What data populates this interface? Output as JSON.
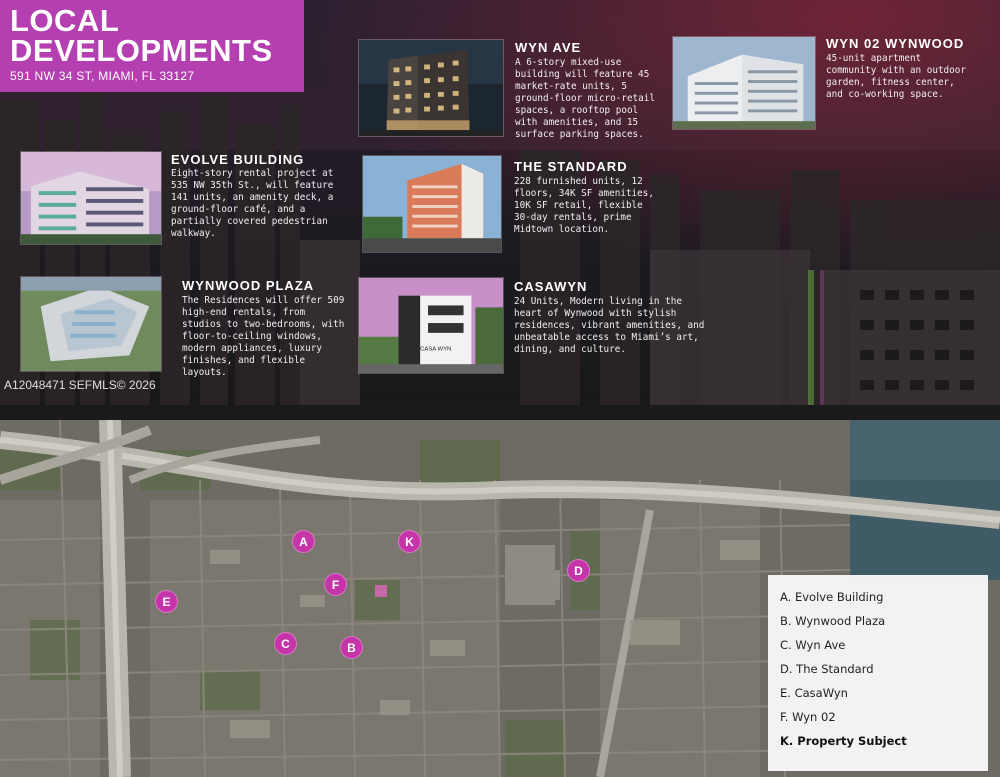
{
  "header": {
    "title": "LOCAL DEVELOPMENTS",
    "address": "591 NW 34 ST, MIAMI, FL 33127"
  },
  "developments": [
    {
      "id": "wyn-ave",
      "title": "WYN AVE",
      "text": "A 6-story mixed-use building will feature 45 market-rate units, 5 ground-floor micro-retail spaces, a rooftop pool with amenities, and 15 surface parking spaces."
    },
    {
      "id": "wyn-02",
      "title": "WYN 02 WYNWOOD",
      "text": "45-unit apartment community with an outdoor garden, fitness center, and co-working space."
    },
    {
      "id": "evolve",
      "title": "EVOLVE BUILDING",
      "text": "Eight-story rental project at 535 NW 35th St., will feature 141 units, an amenity deck, a ground-floor café, and a partially covered pedestrian walkway."
    },
    {
      "id": "standard",
      "title": "THE STANDARD",
      "text": "228 furnished units, 12 floors, 34K SF amenities, 10K SF retail, flexible 30-day rentals, prime Midtown location."
    },
    {
      "id": "wynwood-plaza",
      "title": "WYNWOOD PLAZA",
      "text": "The Residences will offer 509 high-end rentals, from studios to two-bedrooms, with floor-to-ceiling windows, modern appliances, luxury finishes, and flexible layouts."
    },
    {
      "id": "casawyn",
      "title": "CASAWYN",
      "text": "24 Units, Modern living in the heart of Wynwood with stylish residences, vibrant amenities, and unbeatable access to Miami’s art, dining, and culture.",
      "sign": "CASA WYN"
    }
  ],
  "watermark": "A12048471  SEFMLS© 2026",
  "map": {
    "markers": [
      {
        "label": "A"
      },
      {
        "label": "K"
      },
      {
        "label": "D"
      },
      {
        "label": "F"
      },
      {
        "label": "E"
      },
      {
        "label": "C"
      },
      {
        "label": "B"
      }
    ],
    "legend": [
      "A. Evolve Building",
      "B. Wynwood Plaza",
      "C. Wyn Ave",
      "D. The Standard",
      "E. CasaWyn",
      "F. Wyn 02",
      "K. Property Subject"
    ],
    "colors": {
      "marker": "#c534a8",
      "title_box": "#b43fb0"
    }
  }
}
